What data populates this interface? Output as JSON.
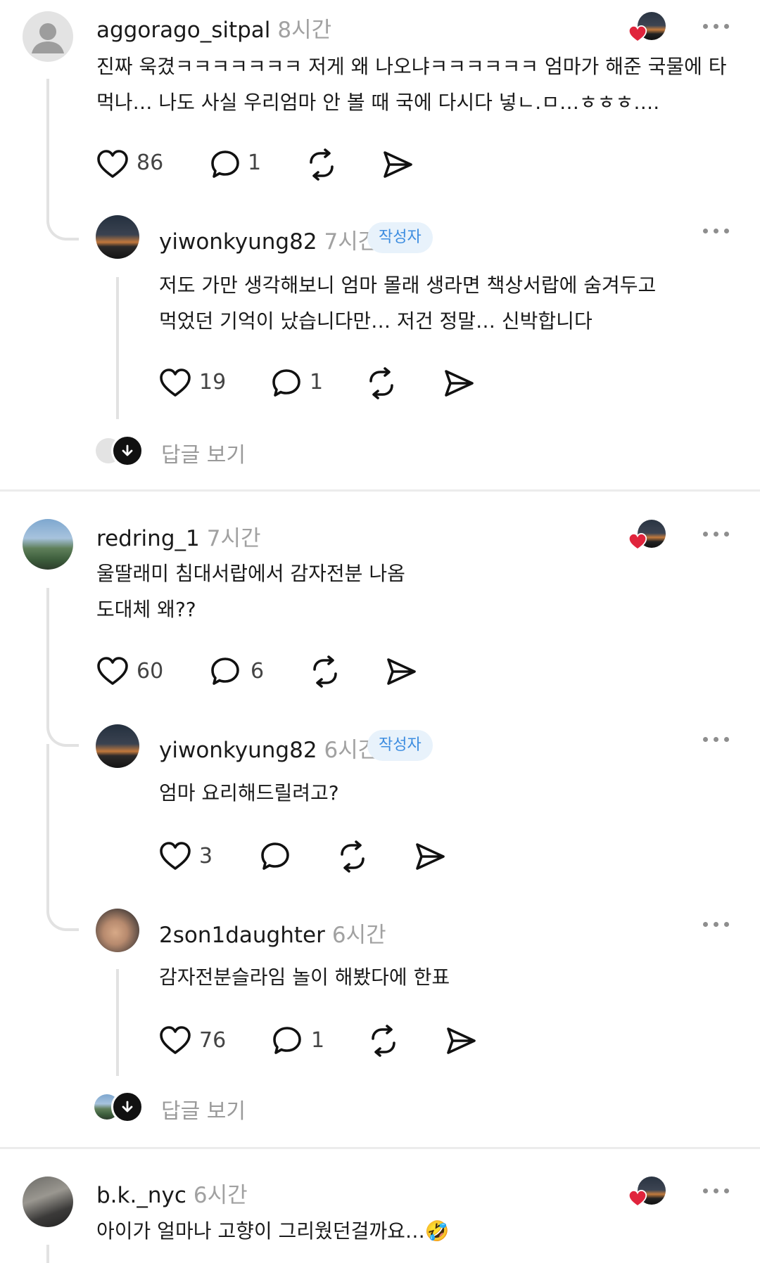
{
  "colors": {
    "accent_badge_bg": "#e8f2fb",
    "accent_badge_text": "#3d8de0",
    "like_heart": "#e0243c",
    "muted_text": "#a1a1a1"
  },
  "comments": [
    {
      "username": "aggorago_sitpal",
      "time": "8시간",
      "lines": [
        "진짜 욱겼ㅋㅋㅋㅋㅋㅋㅋ 저게 왜 나오냐ㅋㅋㅋㅋㅋㅋ 엄마가 해준 국물에 타",
        "먹나… 나도 사실 우리엄마 안 볼 때 국에 다시다 넣ㄴ.ㅁ…ㅎㅎㅎ…."
      ],
      "likes": "86",
      "replies": "1"
    },
    {
      "username": "yiwonkyung82",
      "time": "7시간",
      "badge": "작성자",
      "lines": [
        "저도 가만 생각해보니 엄마 몰래 생라면 책상서랍에 숨겨두고",
        "먹었던 기억이 났습니다만… 저건 정말… 신박합니다"
      ],
      "likes": "19",
      "replies": "1"
    },
    {
      "view_replies": "답글 보기"
    },
    {
      "username": "redring_1",
      "time": "7시간",
      "lines": [
        "울딸래미 침대서랍에서 감자전분 나옴",
        "도대체 왜??"
      ],
      "likes": "60",
      "replies": "6"
    },
    {
      "username": "yiwonkyung82",
      "time": "6시간",
      "badge": "작성자",
      "lines": [
        "엄마 요리해드릴려고?"
      ],
      "likes": "3",
      "replies": ""
    },
    {
      "username": "2son1daughter",
      "time": "6시간",
      "lines": [
        "감자전분슬라임 놀이 해봤다에 한표"
      ],
      "likes": "76",
      "replies": "1"
    },
    {
      "view_replies": "답글 보기"
    },
    {
      "username": "b.k._nyc",
      "time": "6시간",
      "lines": [
        "아이가 얼마나 고향이 그리웠던걸까요…🤣"
      ]
    }
  ]
}
